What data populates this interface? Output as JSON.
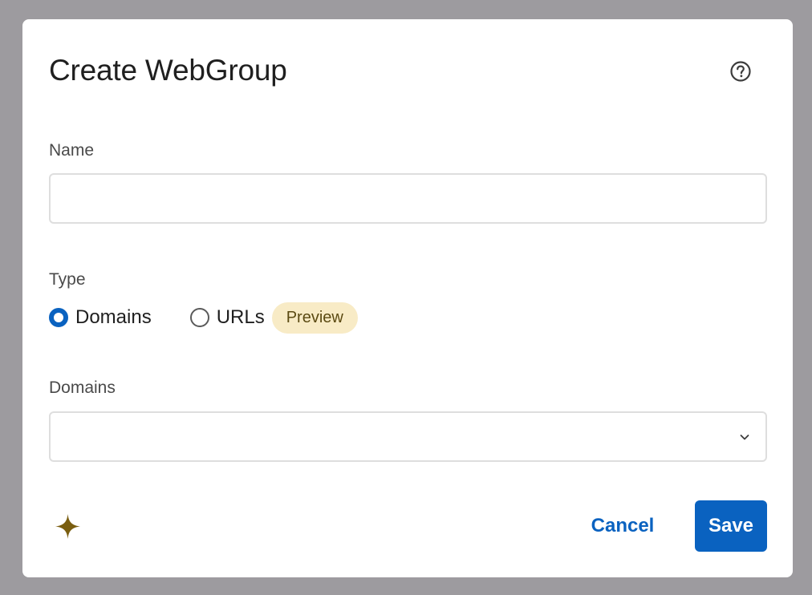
{
  "dialog": {
    "title": "Create WebGroup",
    "help_icon": "help-circle-icon"
  },
  "name_field": {
    "label": "Name",
    "value": "",
    "placeholder": ""
  },
  "type_field": {
    "label": "Type",
    "options": [
      {
        "label": "Domains",
        "selected": true
      },
      {
        "label": "URLs",
        "selected": false,
        "badge": "Preview"
      }
    ]
  },
  "domains_field": {
    "label": "Domains",
    "value": "",
    "icon": "chevron-down-icon"
  },
  "footer": {
    "assistant_icon": "sparkle-icon",
    "cancel_label": "Cancel",
    "save_label": "Save"
  },
  "colors": {
    "primary": "#0a62c0",
    "badge_bg": "#f8ebc6",
    "badge_text": "#5b4a12",
    "sparkle": "#7a5e10",
    "overlay": "#9d9b9f"
  }
}
